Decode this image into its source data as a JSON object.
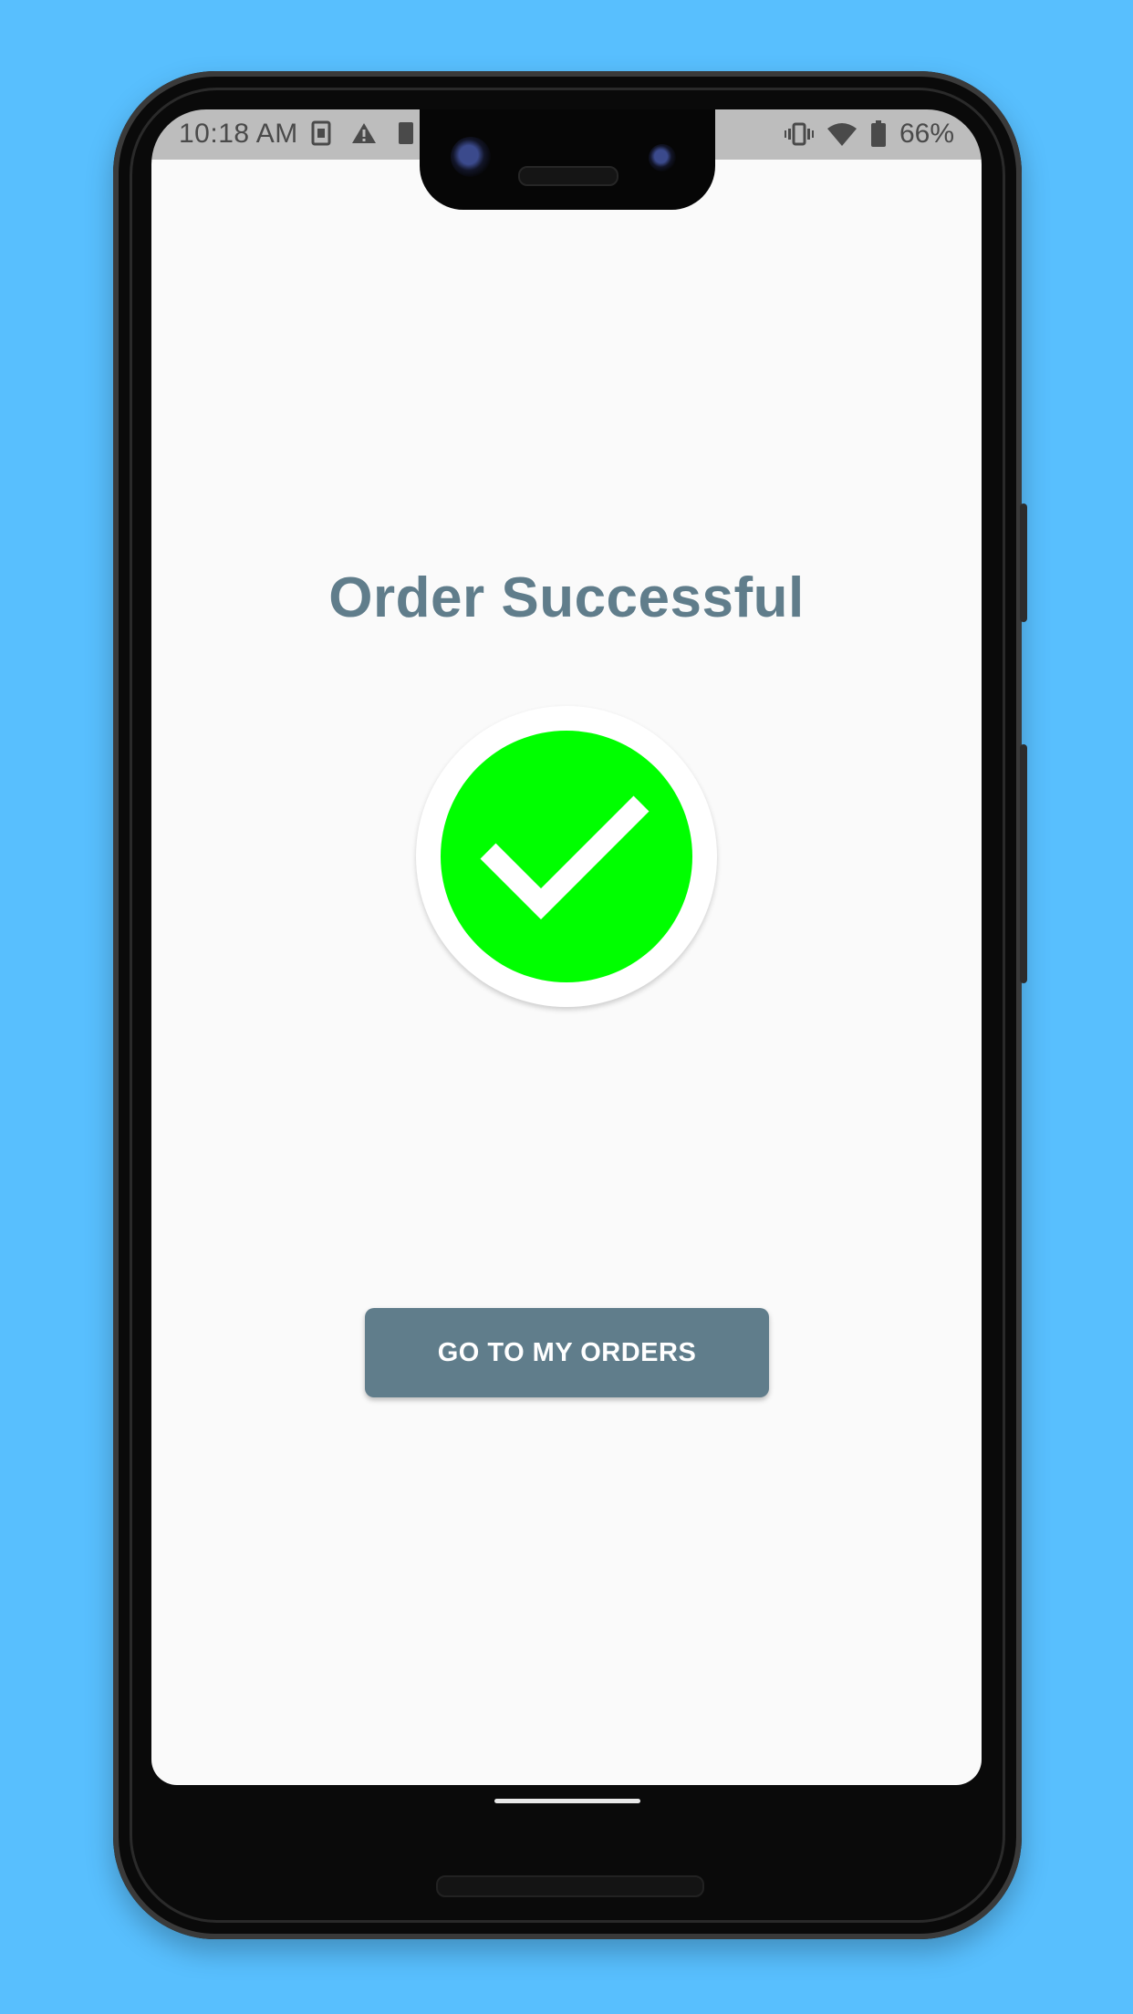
{
  "status_bar": {
    "time": "10:18 AM",
    "battery_percent": "66%",
    "icons_left": [
      "sim-card-icon",
      "warning-icon",
      "notification-icon"
    ],
    "icons_right": [
      "vibrate-icon",
      "wifi-icon",
      "battery-icon"
    ]
  },
  "screen": {
    "title": "Order Successful",
    "success_icon": "check-circle-icon",
    "success_color": "#00FF00",
    "button_label": "GO TO MY ORDERS",
    "accent_color": "#607D8B"
  }
}
